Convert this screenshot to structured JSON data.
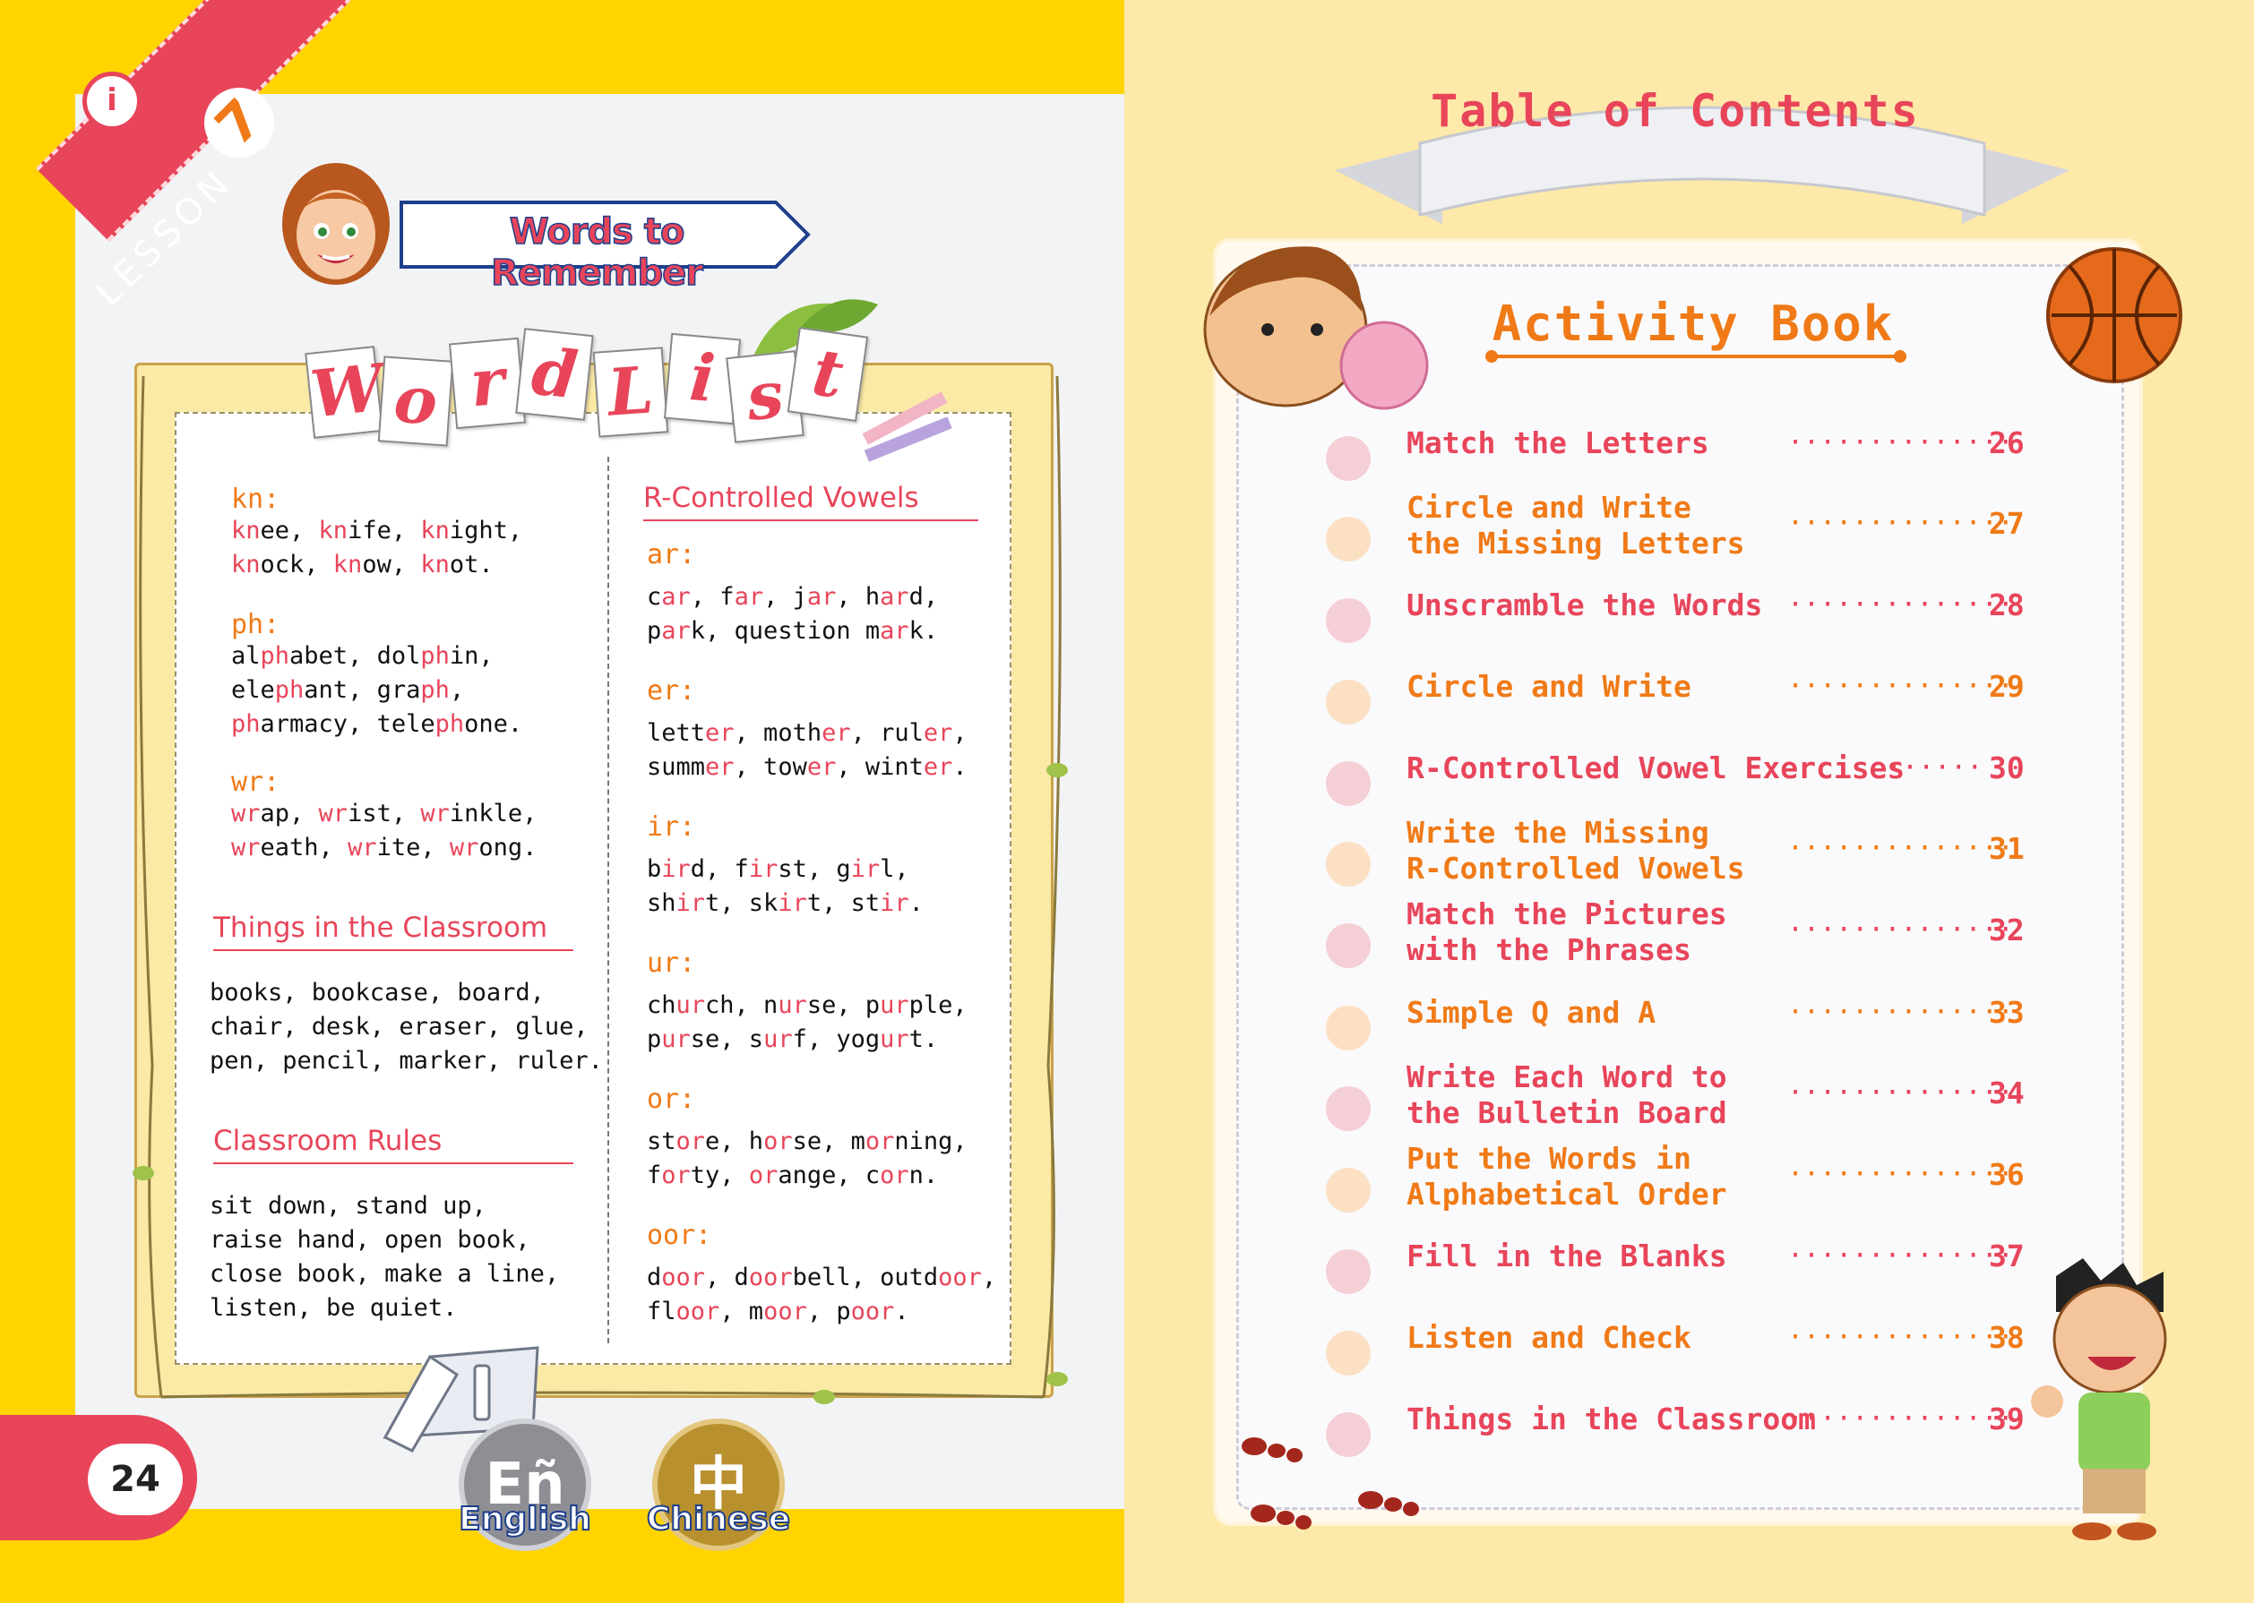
{
  "left": {
    "lesson_label": "LESSON",
    "lesson_number": "7",
    "bulb_glyph": "i",
    "banner_title": "Words to Remember",
    "word_list_letters": [
      "W",
      "o",
      "r",
      "d",
      "L",
      "i",
      "s",
      "t"
    ],
    "page_number": "24",
    "lang_en_glyph": "Eñ",
    "lang_en_label": "English",
    "lang_zh_glyph": "中",
    "lang_zh_label": "Chinese",
    "col1": {
      "kn_key": "kn:",
      "ph_key": "ph:",
      "wr_key": "wr:",
      "classroom_title": "Things in the Classroom",
      "classroom_lines": [
        "books, bookcase, board,",
        "chair, desk, eraser, glue,",
        "pen, pencil, marker, ruler."
      ],
      "rules_title": "Classroom Rules",
      "rules_lines": [
        "sit down, stand up,",
        "raise hand, open book,",
        "close book, make a line,",
        "listen, be quiet."
      ]
    },
    "col2": {
      "title": "R-Controlled Vowels",
      "ar_key": "ar:",
      "er_key": "er:",
      "ir_key": "ir:",
      "ur_key": "ur:",
      "or_key": "or:",
      "oor_key": "oor:"
    },
    "colors": {
      "yellow": "#ffd400",
      "red": "#e8455a",
      "orange": "#f07a17"
    }
  },
  "right": {
    "banner_title": "Table of Contents",
    "subtitle": "Activity Book",
    "items": [
      {
        "label": "Match the Letters",
        "page": "26",
        "color": "red"
      },
      {
        "label": "Circle and Write\nthe Missing Letters",
        "page": "27",
        "color": "orange"
      },
      {
        "label": "Unscramble the Words",
        "page": "28",
        "color": "red"
      },
      {
        "label": "Circle and Write",
        "page": "29",
        "color": "orange"
      },
      {
        "label": "R-Controlled Vowel Exercises",
        "page": "30",
        "color": "red"
      },
      {
        "label": "Write the Missing\nR-Controlled Vowels",
        "page": "31",
        "color": "orange"
      },
      {
        "label": "Match the Pictures\nwith the Phrases",
        "page": "32",
        "color": "red"
      },
      {
        "label": "Simple Q and A",
        "page": "33",
        "color": "orange"
      },
      {
        "label": "Write Each Word to\nthe Bulletin Board",
        "page": "34",
        "color": "red"
      },
      {
        "label": "Put the Words in\nAlphabetical Order",
        "page": "36",
        "color": "orange"
      },
      {
        "label": "Fill in the Blanks",
        "page": "37",
        "color": "red"
      },
      {
        "label": "Listen and Check",
        "page": "38",
        "color": "orange"
      },
      {
        "label": "Things in the Classroom",
        "page": "39",
        "color": "red"
      }
    ]
  }
}
